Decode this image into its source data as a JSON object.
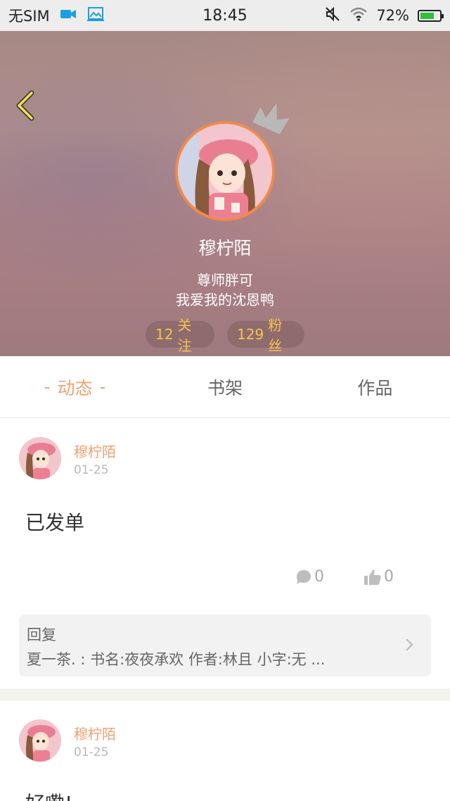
{
  "status_bar": {
    "carrier": "无SIM",
    "time": "18:45",
    "battery_percent": "72%",
    "battery_level": 0.72,
    "icons": [
      "video-icon",
      "image-icon",
      "mute-icon",
      "wifi-icon",
      "battery-icon"
    ]
  },
  "profile": {
    "name": "穆柠陌",
    "bio_line1": "尊师胖可",
    "bio_line2": "我爱我的沈恩鸭",
    "following_count": "12",
    "following_label": "关注",
    "fans_count": "129",
    "fans_label": "粉丝"
  },
  "tabs": [
    {
      "label": "动态",
      "active": true
    },
    {
      "label": "书架",
      "active": false
    },
    {
      "label": "作品",
      "active": false
    }
  ],
  "tab_active_dash": "-",
  "posts": [
    {
      "user": "穆柠陌",
      "date": "01-25",
      "text": "已发单",
      "comments": "0",
      "likes": "0",
      "reply": {
        "label": "回复",
        "text": "夏一茶. : 书名:夜夜承欢  作者:林且  小字:无  ..."
      }
    },
    {
      "user": "穆柠陌",
      "date": "01-25",
      "text": "好嘞!"
    }
  ],
  "colors": {
    "accent_orange": "#f0a070",
    "pill_text": "#f6c34a",
    "avatar_border": "#f08a4c",
    "back_arrow": "#f3e04e"
  }
}
